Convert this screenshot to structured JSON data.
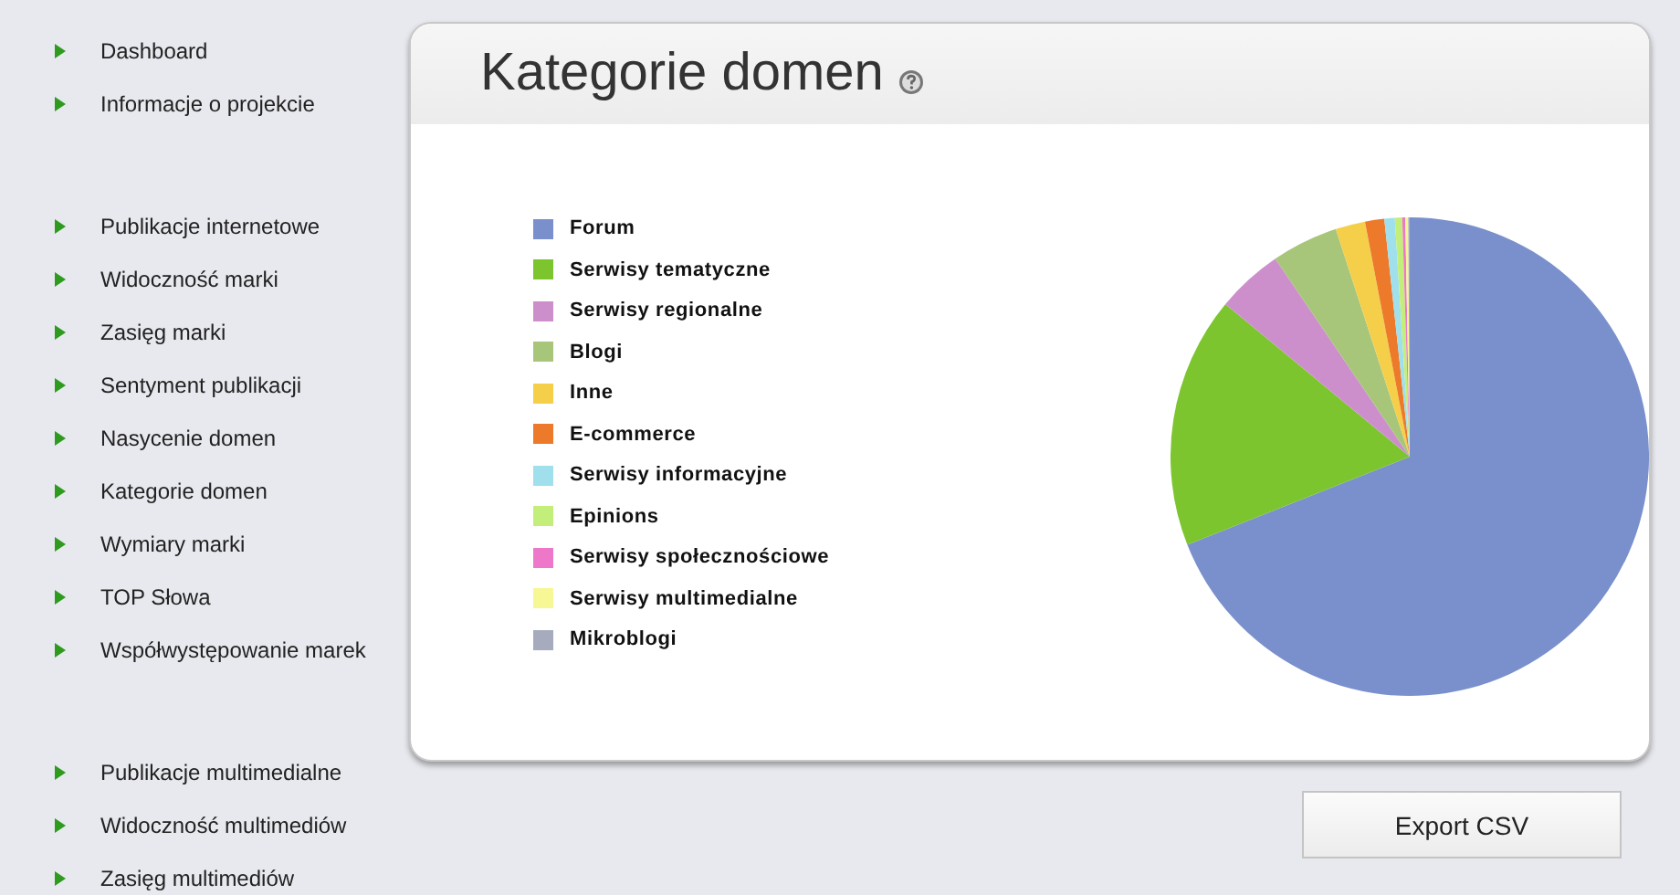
{
  "sidebar": {
    "groups": [
      {
        "items": [
          {
            "label": "Dashboard"
          },
          {
            "label": "Informacje o projekcie"
          }
        ]
      },
      {
        "items": [
          {
            "label": "Publikacje internetowe"
          },
          {
            "label": "Widoczność marki"
          },
          {
            "label": "Zasięg marki"
          },
          {
            "label": "Sentyment publikacji"
          },
          {
            "label": "Nasycenie domen"
          },
          {
            "label": "Kategorie domen"
          },
          {
            "label": "Wymiary marki"
          },
          {
            "label": "TOP Słowa"
          },
          {
            "label": "Współwystępowanie marek"
          }
        ]
      },
      {
        "items": [
          {
            "label": "Publikacje multimedialne"
          },
          {
            "label": "Widoczność multimediów"
          },
          {
            "label": "Zasięg multimediów"
          }
        ]
      }
    ]
  },
  "panel": {
    "title": "Kategorie domen",
    "legend": [
      {
        "label": "Forum",
        "color": "#7990cc"
      },
      {
        "label": "Serwisy tematyczne",
        "color": "#7cc52e"
      },
      {
        "label": "Serwisy regionalne",
        "color": "#cc8fcc"
      },
      {
        "label": "Blogi",
        "color": "#a8c67a"
      },
      {
        "label": "Inne",
        "color": "#f5cf4a"
      },
      {
        "label": "E-commerce",
        "color": "#ec7a2a"
      },
      {
        "label": "Serwisy informacyjne",
        "color": "#9fe0ec"
      },
      {
        "label": "Epinions",
        "color": "#c4ee7a"
      },
      {
        "label": "Serwisy społecznościowe",
        "color": "#ef77c9"
      },
      {
        "label": "Serwisy multimedialne",
        "color": "#f7f796"
      },
      {
        "label": "Mikroblogi",
        "color": "#a6abbe"
      }
    ]
  },
  "export_button": "Export CSV"
}
